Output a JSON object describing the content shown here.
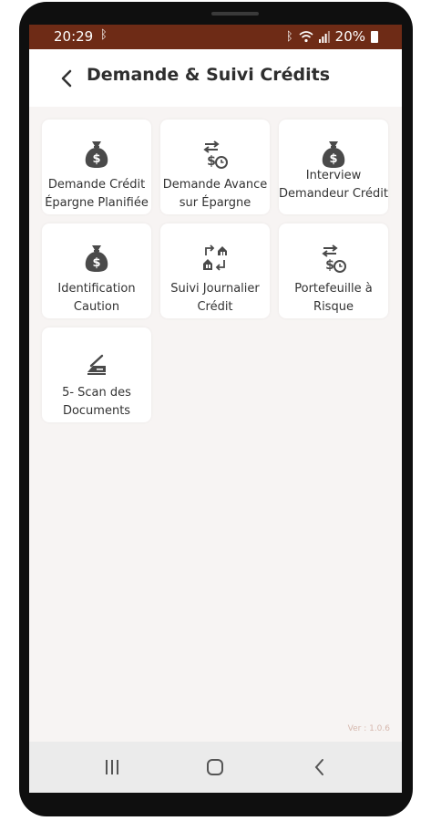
{
  "status": {
    "time": "20:29",
    "battery": "20%",
    "icons": [
      "bluetooth-icon",
      "wifi-icon",
      "signal-icon",
      "battery-icon"
    ]
  },
  "appbar": {
    "title": "Demande & Suivi Crédits",
    "back_icon": "arrow-left-icon"
  },
  "tiles": [
    {
      "label": "Demande Crédit Épargne Planifiée",
      "icon": "money-bag-icon"
    },
    {
      "label": "Demande Avance sur Épargne",
      "icon": "money-transfer-clock-icon"
    },
    {
      "label": "Interview Demandeur Crédit",
      "icon": "money-bag-icon"
    },
    {
      "label": "Identification Caution",
      "icon": "money-bag-icon"
    },
    {
      "label": "Suivi Journalier Crédit",
      "icon": "house-exchange-icon"
    },
    {
      "label": "Portefeuille à Risque",
      "icon": "money-transfer-clock-icon"
    },
    {
      "label": "5- Scan des Documents",
      "icon": "scanner-icon"
    }
  ],
  "version": "Ver : 1.0.6",
  "navbar": {
    "buttons": [
      "recents-icon",
      "home-icon",
      "back-icon"
    ]
  },
  "colors": {
    "statusbar": "#6e2b16",
    "background": "#f7f4f3",
    "tile": "#ffffff",
    "text": "#333333",
    "icon": "#4a4a4a",
    "version": "#d6b8ae"
  }
}
